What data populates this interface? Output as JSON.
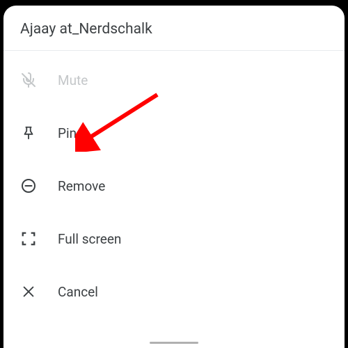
{
  "header": {
    "title": "Ajaay at_Nerdschalk"
  },
  "menu": {
    "mute": {
      "label": "Mute",
      "icon": "mic-off-icon",
      "interactable": false
    },
    "pin": {
      "label": "Pin",
      "icon": "pin-icon",
      "interactable": true
    },
    "remove": {
      "label": "Remove",
      "icon": "remove-icon",
      "interactable": true
    },
    "fullscreen": {
      "label": "Full screen",
      "icon": "fullscreen-icon",
      "interactable": true
    },
    "cancel": {
      "label": "Cancel",
      "icon": "close-icon",
      "interactable": true
    }
  },
  "annotation": {
    "arrow_color": "#ff0000",
    "target": "pin"
  }
}
